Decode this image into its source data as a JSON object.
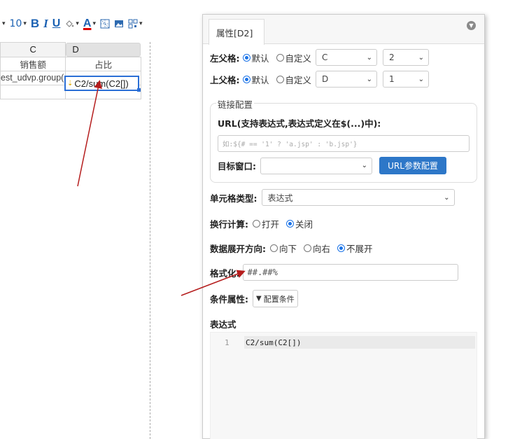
{
  "toolbar": {
    "font_size": "10",
    "bold": "B",
    "italic": "I",
    "underline": "U",
    "font_color": "A"
  },
  "sheet": {
    "col_headers": [
      "C",
      "D"
    ],
    "header_row": [
      "销售额",
      "占比"
    ],
    "row2_c": "est_udvp.group(",
    "row2_d": "C2/sum(C2[])",
    "expand_icon": "⇣"
  },
  "panel": {
    "tab": "属性[D2]",
    "left_parent": {
      "label": "左父格:",
      "opt_default": "默认",
      "opt_custom": "自定义",
      "col": "C",
      "row": "2"
    },
    "top_parent": {
      "label": "上父格:",
      "opt_default": "默认",
      "opt_custom": "自定义",
      "col": "D",
      "row": "1"
    },
    "link": {
      "legend": "链接配置",
      "url_label": "URL(支持表达式,表达式定义在$(...)中):",
      "url_placeholder": "如:${# == '1' ? 'a.jsp' : 'b.jsp'}",
      "target_label": "目标窗口:",
      "target_value": "",
      "param_button": "URL参数配置"
    },
    "cell_type": {
      "label": "单元格类型:",
      "value": "表达式"
    },
    "wrap_calc": {
      "label": "换行计算:",
      "opt_on": "打开",
      "opt_off": "关闭"
    },
    "expand_dir": {
      "label": "数据展开方向:",
      "opt_down": "向下",
      "opt_right": "向右",
      "opt_none": "不展开"
    },
    "format": {
      "label": "格式化:",
      "value": "##.##%"
    },
    "condition": {
      "label": "条件属性:",
      "button": "配置条件"
    },
    "expression": {
      "label": "表达式",
      "line_no": "1",
      "code": "C2/sum(C2[])"
    }
  },
  "colors": {
    "accent": "#1a73e8",
    "button": "#2d77c8",
    "arrow": "#b51d1d",
    "selection": "#2b6fd6"
  }
}
